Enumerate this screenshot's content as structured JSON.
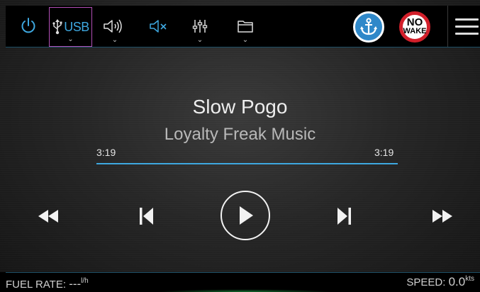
{
  "topbar": {
    "usb_label": "USB",
    "chevron": "⌄",
    "icons": {
      "power": "power-icon",
      "usb": "usb-icon",
      "volume": "volume-icon",
      "mute": "mute-icon",
      "equalizer": "equalizer-icon",
      "folder": "folder-icon",
      "anchor": "anchor-icon",
      "menu": "menu-icon"
    },
    "nowake": {
      "line1": "NO",
      "line2": "WAKE"
    }
  },
  "track": {
    "title": "Slow Pogo",
    "artist": "Loyalty Freak Music",
    "elapsed": "3:19",
    "duration": "3:19",
    "progress_fraction": 1.0
  },
  "controls": [
    "rewind-icon",
    "previous-track-icon",
    "play-icon",
    "next-track-icon",
    "fast-forward-icon"
  ],
  "status": {
    "fuel_label": "FUEL RATE: ",
    "fuel_value": "---",
    "fuel_unit": "l/h",
    "speed_label": "SPEED: ",
    "speed_value": "0.0",
    "speed_unit": "kts"
  },
  "colors": {
    "accent": "#3ea8e0",
    "usb_border": "#b34fb7",
    "anchor_badge": "#2f88c9",
    "nowake_ring": "#d21f2a"
  }
}
